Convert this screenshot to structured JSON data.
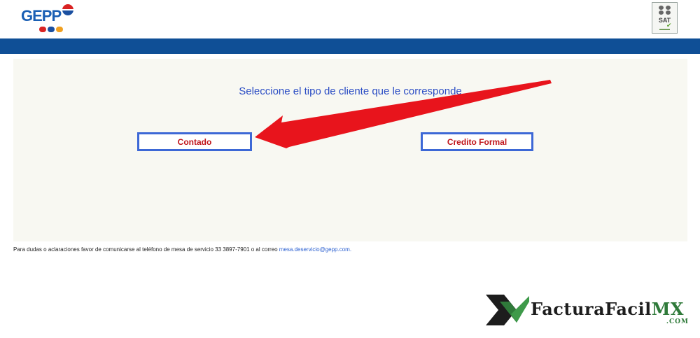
{
  "header": {
    "logo_text": "GEPP",
    "sat_logo_text": "SAT"
  },
  "panel": {
    "title": "Seleccione el tipo de cliente que le corresponde",
    "buttons": {
      "contado": "Contado",
      "credito": "Credito Formal"
    }
  },
  "footer": {
    "text": "Para dudas o aclaraciones favor de comunicarse al teléfono de mesa de servicio 33 3897-7901 o al correo ",
    "email": "mesa.deservicio@gepp.com."
  },
  "watermark": {
    "main": "FacturaFacil",
    "accent": "MX",
    "suffix": ".COM"
  },
  "colors": {
    "bar": "#0f4f96",
    "title": "#2a4cc4",
    "button_border": "#3d68d6",
    "button_text": "#c0141a",
    "arrow": "#e8141c"
  }
}
